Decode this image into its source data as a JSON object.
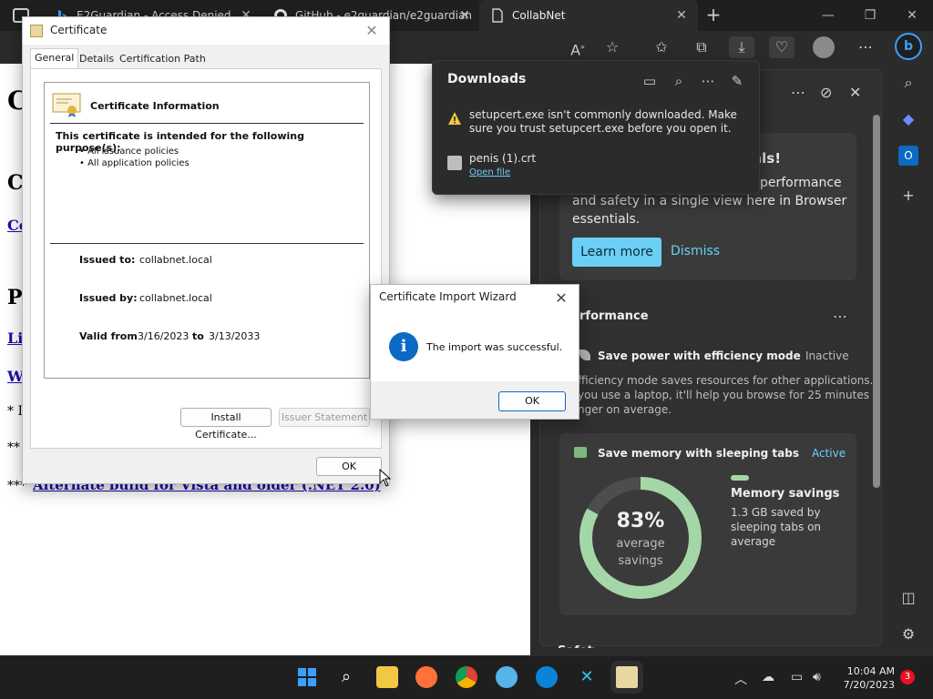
{
  "tabs": [
    {
      "label": "E2Guardian - Access Denied",
      "icon": "bing-icon"
    },
    {
      "label": "GitHub - e2guardian/e2guardian",
      "icon": "github-icon"
    },
    {
      "label": "CollabNet",
      "icon": "page-icon"
    }
  ],
  "new_tab_glyph": "+",
  "window_controls": {
    "minimize": "—",
    "restore": "❐",
    "close": "✕"
  },
  "page": {
    "fragments": [
      "C",
      "C",
      "Co",
      "P",
      "Li",
      "W"
    ],
    "stars_1": "* I",
    "stars_2": "**",
    "stars_3": "***",
    "alt_link": "Alternate build for Vista and older (.NET 2.0)"
  },
  "downloads": {
    "title": "Downloads",
    "warning": "setupcert.exe isn't commonly downloaded. Make sure you trust setupcert.exe before you open it.",
    "file_name": "penis (1).crt",
    "open_file": "Open file"
  },
  "essentials": {
    "card_heading_fragment": "als!",
    "card_line1": "performance",
    "card_line2": "and safety in a single view here in Browser",
    "card_line3": "essentials.",
    "learn_more": "Learn more",
    "dismiss": "Dismiss",
    "performance_title": "rformance",
    "efficiency_title": "Save power with efficiency mode",
    "efficiency_status": "Inactive",
    "efficiency_desc1": "fficiency mode saves resources for other applications.",
    "efficiency_desc2": "you use a laptop, it'll help you browse for 25 minutes",
    "efficiency_desc3": "nger on average.",
    "sleep_title": "Save memory with sleeping tabs",
    "sleep_status": "Active",
    "ring_percent": "83%",
    "ring_label1": "average",
    "ring_label2": "savings",
    "ring_value": 0.83,
    "mem_title": "Memory savings",
    "mem_desc1": "1.3 GB saved by",
    "mem_desc2": "sleeping tabs on",
    "mem_desc3": "average",
    "footer_fragment": "Safety"
  },
  "certificate": {
    "title": "Certificate",
    "tabs": [
      "General",
      "Details",
      "Certification Path"
    ],
    "info_title": "Certificate Information",
    "purpose": "This certificate is intended for the following purpose(s):",
    "bullets": [
      "• All issuance policies",
      "• All application policies"
    ],
    "issued_to_label": "Issued to:",
    "issued_to": "collabnet.local",
    "issued_by_label": "Issued by:",
    "issued_by": "collabnet.local",
    "valid_from_label": "Valid from",
    "valid_from": "3/16/2023",
    "valid_to_label": "to",
    "valid_to": "3/13/2033",
    "install_btn": "Install Certificate...",
    "issuer_btn": "Issuer Statement",
    "ok_btn": "OK"
  },
  "wizard": {
    "title": "Certificate Import Wizard",
    "message": "The import was successful.",
    "ok_btn": "OK"
  },
  "taskbar": {
    "time": "10:04 AM",
    "date": "7/20/2023",
    "notifications": "3"
  }
}
